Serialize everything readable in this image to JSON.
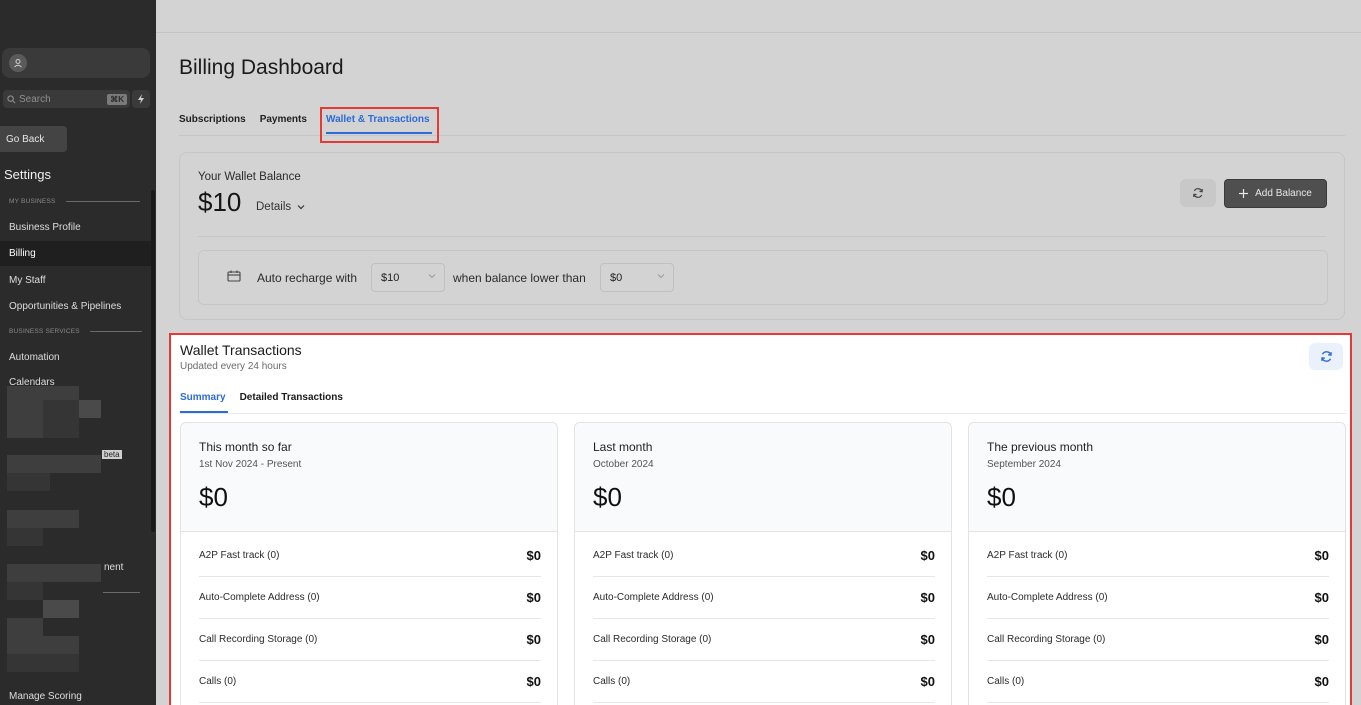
{
  "sidebar": {
    "search_placeholder": "Search",
    "search_shortcut": "⌘K",
    "go_back": "Go Back",
    "settings_title": "Settings",
    "section_my_business": "MY BUSINESS",
    "section_business_services": "BUSINESS SERVICES",
    "items": {
      "business_profile": "Business Profile",
      "billing": "Billing",
      "my_staff": "My Staff",
      "opportunities": "Opportunities & Pipelines",
      "automation": "Automation",
      "calendars": "Calendars",
      "manage_scoring": "Manage Scoring"
    },
    "beta_badge": "beta",
    "fragment_text": "nent"
  },
  "page": {
    "title": "Billing Dashboard",
    "tabs": [
      "Subscriptions",
      "Payments"
    ],
    "active_tab": "Wallet & Transactions"
  },
  "wallet": {
    "label": "Your Wallet Balance",
    "balance": "$10",
    "details": "Details",
    "add_balance": "Add Balance",
    "recharge_label": "Auto recharge with",
    "recharge_amount": "$10",
    "threshold_label": "when balance lower than",
    "threshold_amount": "$0"
  },
  "transactions": {
    "title": "Wallet Transactions",
    "subtitle": "Updated every 24 hours",
    "tabs": {
      "summary": "Summary",
      "detailed": "Detailed Transactions"
    },
    "periods": [
      {
        "title": "This month so far",
        "range": "1st Nov 2024 - Present",
        "total": "$0",
        "rows": [
          {
            "name": "A2P Fast track (0)",
            "amount": "$0"
          },
          {
            "name": "Auto-Complete Address (0)",
            "amount": "$0"
          },
          {
            "name": "Call Recording Storage (0)",
            "amount": "$0"
          },
          {
            "name": "Calls (0)",
            "amount": "$0"
          }
        ]
      },
      {
        "title": "Last month",
        "range": "October 2024",
        "total": "$0",
        "rows": [
          {
            "name": "A2P Fast track (0)",
            "amount": "$0"
          },
          {
            "name": "Auto-Complete Address (0)",
            "amount": "$0"
          },
          {
            "name": "Call Recording Storage (0)",
            "amount": "$0"
          },
          {
            "name": "Calls (0)",
            "amount": "$0"
          }
        ]
      },
      {
        "title": "The previous month",
        "range": "September 2024",
        "total": "$0",
        "rows": [
          {
            "name": "A2P Fast track (0)",
            "amount": "$0"
          },
          {
            "name": "Auto-Complete Address (0)",
            "amount": "$0"
          },
          {
            "name": "Call Recording Storage (0)",
            "amount": "$0"
          },
          {
            "name": "Calls (0)",
            "amount": "$0"
          }
        ]
      }
    ]
  },
  "colors": {
    "accent": "#2c6bd9",
    "highlight": "#e53935",
    "sidebar_bg": "#2b2b2b",
    "overlay_bg": "#d3d3d3"
  }
}
